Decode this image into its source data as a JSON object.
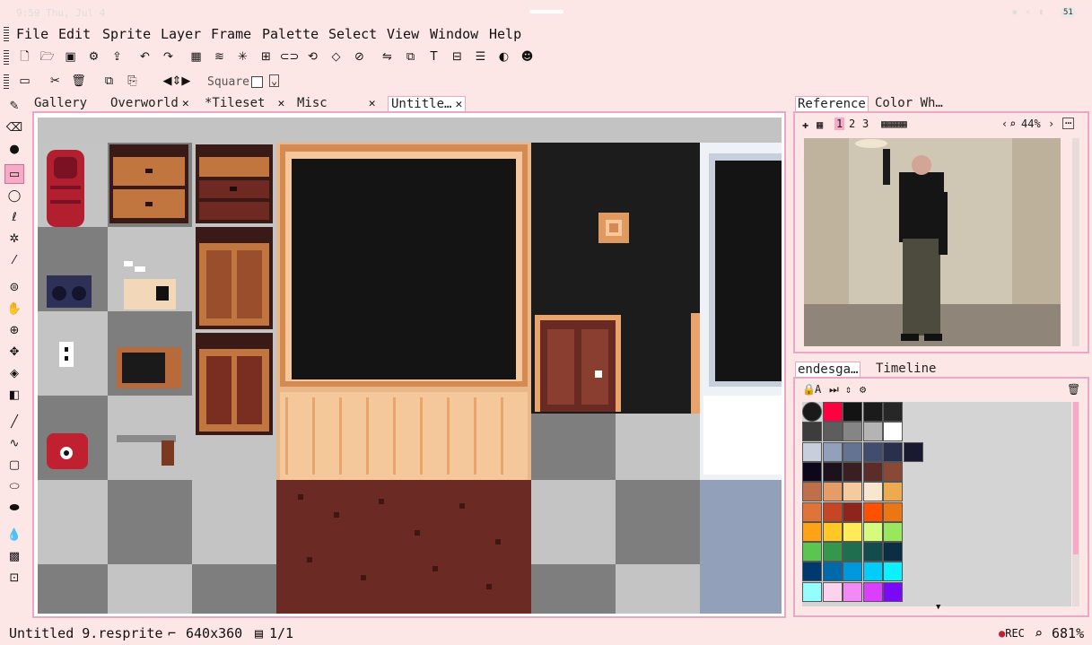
{
  "system": {
    "time": "9:59 Thu, Jul 4",
    "battery": "51"
  },
  "menu": [
    "File",
    "Edit",
    "Sprite",
    "Layer",
    "Frame",
    "Palette",
    "Select",
    "View",
    "Window",
    "Help"
  ],
  "toolbar2": {
    "square_label": "Square"
  },
  "tabs": [
    {
      "label": "Gallery",
      "closable": false
    },
    {
      "label": "Overworld",
      "closable": true
    },
    {
      "label": "*Tileset",
      "closable": true
    },
    {
      "label": "Misc",
      "closable": true
    },
    {
      "label": "Untitle…",
      "closable": true,
      "active": true
    }
  ],
  "reference_panel": {
    "tabs": [
      "Reference",
      "Color Wh…"
    ],
    "tools": [
      "1",
      "2",
      "3"
    ],
    "zoom": "44%"
  },
  "palette_panel": {
    "tabs": [
      "endesga…",
      "Timeline"
    ],
    "colors": [
      "#1a1a1a",
      "#ff0040",
      "#131313",
      "#1b1b1b",
      "#272727",
      "#3d3d3d",
      "#5d5d5d",
      "#858585",
      "#b4b4b4",
      "#ffffff",
      "#c7cfdd",
      "#92a1b9",
      "#657392",
      "#424c6e",
      "#2a2f4e",
      "#1a1932",
      "#0e071b",
      "#1c121c",
      "#391f21",
      "#5d2c28",
      "#8a4836",
      "#bf6f4a",
      "#e69c69",
      "#f6ca9f",
      "#f9e6cf",
      "#edab50",
      "#e07438",
      "#c64524",
      "#8e251d",
      "#ff5000",
      "#ed7614",
      "#ffa214",
      "#ffc825",
      "#ffeb57",
      "#d3fc7e",
      "#99e65f",
      "#5ac54f",
      "#33984b",
      "#1e6f50",
      "#134c4c",
      "#0c2e44",
      "#00396d",
      "#0069aa",
      "#0098dc",
      "#00cdf9",
      "#0cf1ff",
      "#94fdff",
      "#fdd2ed",
      "#f389f5",
      "#db3ffd",
      "#7a09fa"
    ]
  },
  "status": {
    "filename": "Untitled 9.resprite",
    "size": "640x360",
    "frames": "1/1",
    "rec": "REC",
    "zoom": "681%"
  }
}
